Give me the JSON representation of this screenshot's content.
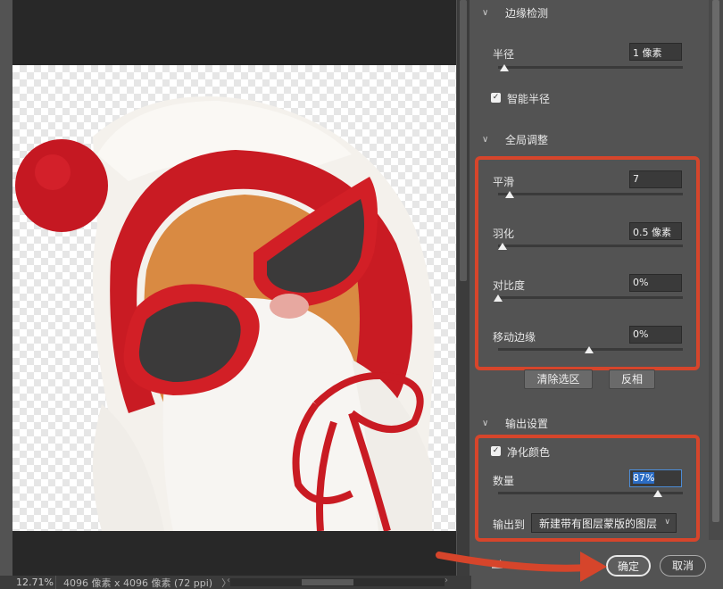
{
  "canvas": {
    "zoom": "12.71%",
    "dimensions": "4096 像素 x 4096 像素 (72 ppi)",
    "nav_arrow": "〉"
  },
  "edge_detection": {
    "header": "边缘检测",
    "radius_label": "半径",
    "radius_value": "1 像素",
    "radius_level": 0.03,
    "smart_radius_label": "智能半径",
    "smart_radius_checked": true
  },
  "global_refine": {
    "header": "全局调整",
    "smooth_label": "平滑",
    "smooth_value": "7",
    "smooth_level": 0.07,
    "feather_label": "羽化",
    "feather_value": "0.5 像素",
    "feather_level": 0.02,
    "contrast_label": "对比度",
    "contrast_value": "0%",
    "contrast_level": 0.0,
    "shift_edge_label": "移动边缘",
    "shift_edge_value": "0%",
    "shift_edge_level": 0.5,
    "clear_selection_label": "清除选区",
    "invert_label": "反相"
  },
  "output_settings": {
    "header": "输出设置",
    "decontaminate_label": "净化颜色",
    "decontaminate_checked": true,
    "amount_label": "数量",
    "amount_value": "87%",
    "amount_level": 0.87,
    "output_to_label": "输出到",
    "output_to_value": "新建带有图层蒙版的图层"
  },
  "footer": {
    "ok_label": "确定",
    "cancel_label": "取消"
  },
  "colors": {
    "highlight": "#d6452b",
    "panel_bg": "#535353",
    "field_bg": "#3a3a3a"
  }
}
